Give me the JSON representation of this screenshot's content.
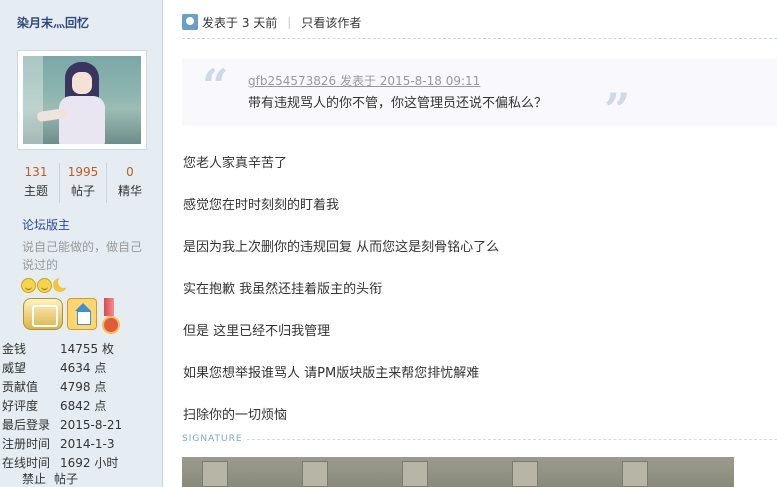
{
  "user": {
    "name": "染月末灬回忆",
    "stats": [
      {
        "num": "131",
        "label": "主题"
      },
      {
        "num": "1995",
        "label": "帖子"
      },
      {
        "num": "0",
        "label": "精华"
      }
    ],
    "group": "论坛版主",
    "short_sig": "说自己能做的，做自己说过的",
    "info": [
      {
        "k": "金钱",
        "v": "14755 枚"
      },
      {
        "k": "威望",
        "v": "4634 点"
      },
      {
        "k": "贡献值",
        "v": "4798 点"
      },
      {
        "k": "好评度",
        "v": "6842 点"
      },
      {
        "k": "最后登录",
        "v": "2015-8-21"
      },
      {
        "k": "注册时间",
        "v": "2014-1-3"
      },
      {
        "k": "在线时间",
        "v": "1692 小时"
      }
    ],
    "links": [
      "禁止",
      "帖子"
    ]
  },
  "post": {
    "time": "发表于 3 天前",
    "only_author": "只看该作者",
    "quote": {
      "author": "gfb254573826 发表于 2015-8-18 09:11",
      "text": "带有违规骂人的你不管，你这管理员还说不偏私么？"
    },
    "lines": [
      "您老人家真辛苦了",
      "感觉您在时时刻刻的盯着我",
      "是因为我上次删你的违规回复 从而您这是刻骨铭心了么",
      "实在抱歉 我虽然还挂着版主的头衔",
      "但是 这里已经不归我管理",
      "如果您想举报谁骂人 请PM版块版主来帮您排忧解难",
      "扫除你的一切烦恼"
    ],
    "signature_label": "SIGNATURE"
  },
  "colors": {
    "sidebar_bg": "#e5edf2",
    "username": "#2b4a78",
    "stat_number": "#c15b1e",
    "group": "#2b4a9a"
  }
}
